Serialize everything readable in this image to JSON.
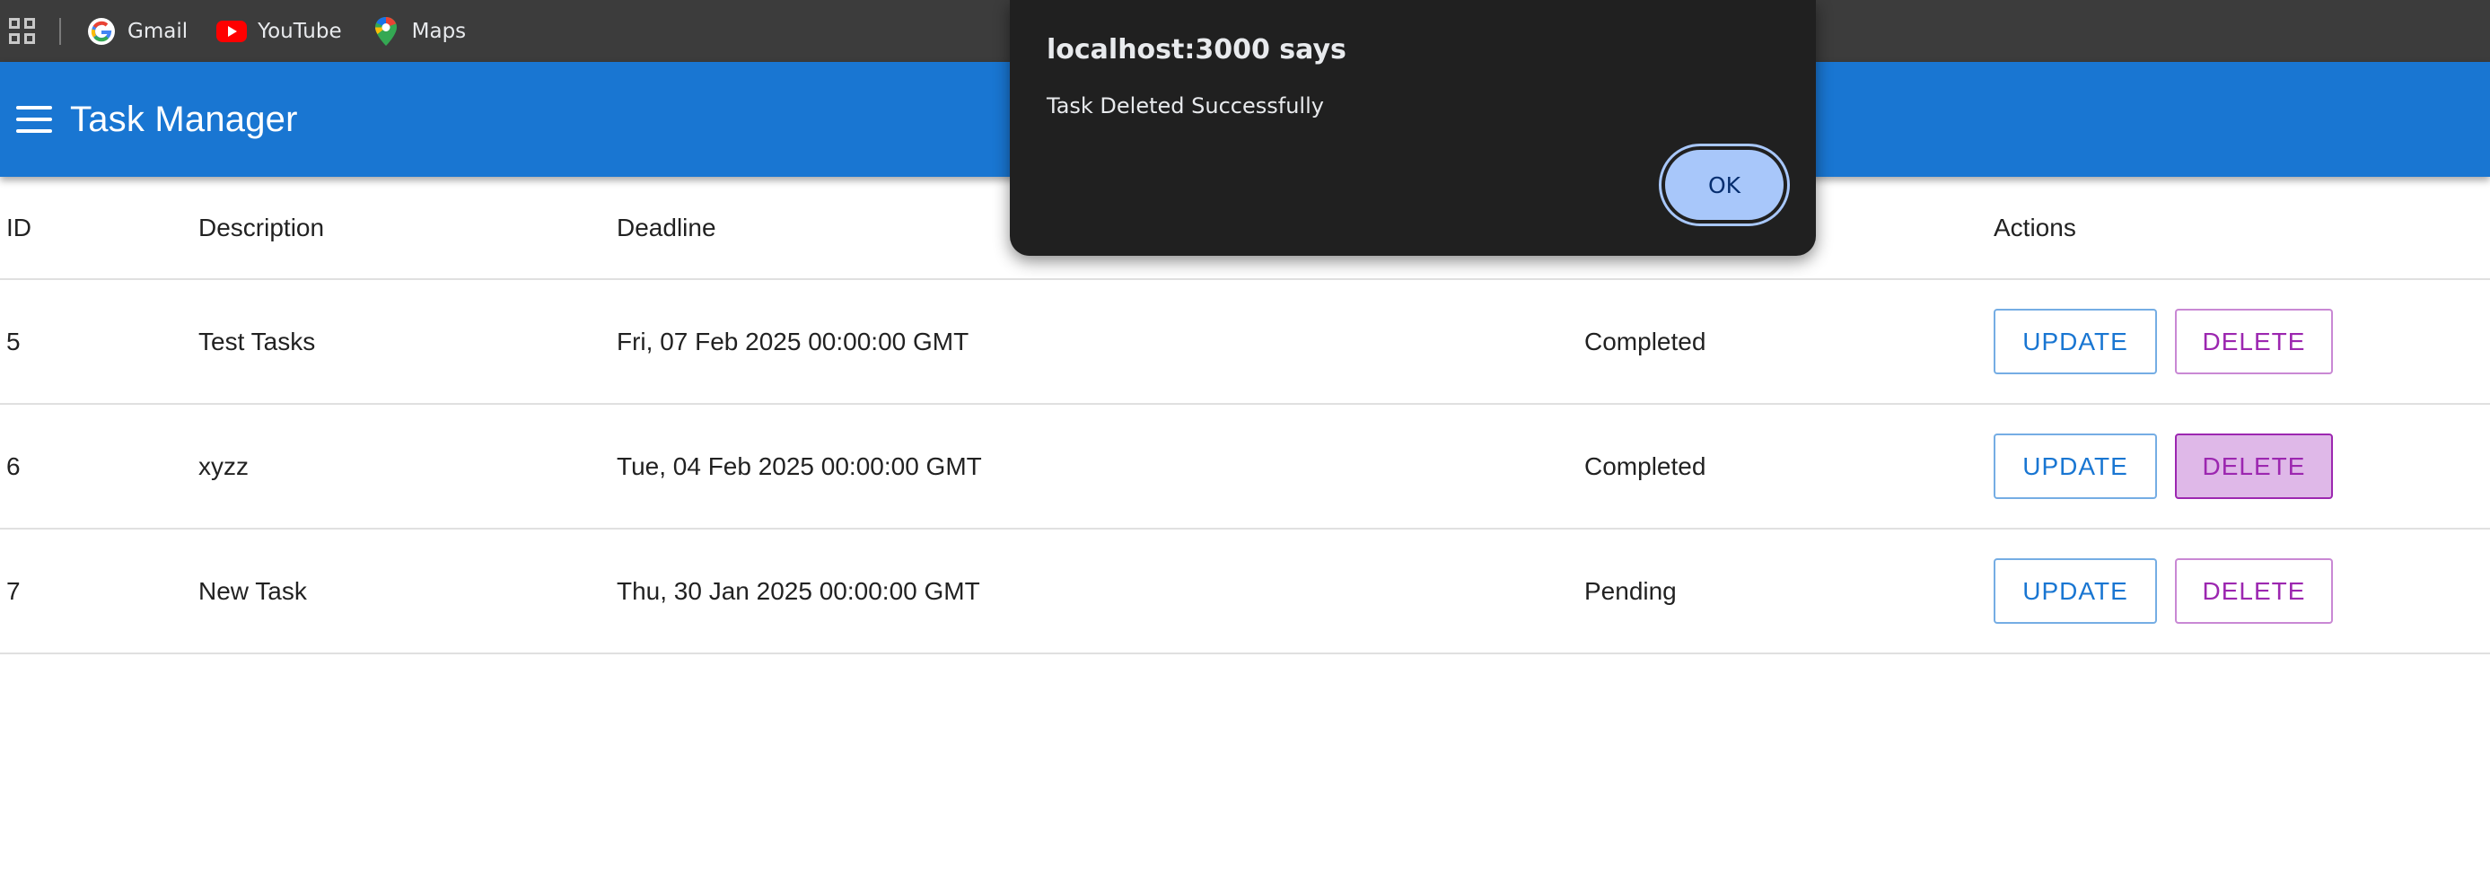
{
  "bookmarks": [
    {
      "label": "Gmail",
      "icon": "google-icon"
    },
    {
      "label": "YouTube",
      "icon": "youtube-icon"
    },
    {
      "label": "Maps",
      "icon": "maps-icon"
    }
  ],
  "app": {
    "title": "Task Manager"
  },
  "table": {
    "headers": {
      "id": "ID",
      "description": "Description",
      "deadline": "Deadline",
      "status": "",
      "actions": "Actions"
    },
    "rows": [
      {
        "id": "5",
        "description": "Test Tasks",
        "deadline": "Fri, 07 Feb 2025 00:00:00 GMT",
        "status": "Completed"
      },
      {
        "id": "6",
        "description": "xyzz",
        "deadline": "Tue, 04 Feb 2025 00:00:00 GMT",
        "status": "Completed"
      },
      {
        "id": "7",
        "description": "New Task",
        "deadline": "Thu, 30 Jan 2025 00:00:00 GMT",
        "status": "Pending"
      }
    ],
    "update_label": "UPDATE",
    "delete_label": "DELETE"
  },
  "alert": {
    "title": "localhost:3000 says",
    "message": "Task Deleted Successfully",
    "ok_label": "OK"
  },
  "colors": {
    "app_bar": "#1976d2",
    "update": "#1976d2",
    "delete": "#9c27b0",
    "alert_bg": "#202020",
    "ok_button": "#a8c7fa"
  }
}
